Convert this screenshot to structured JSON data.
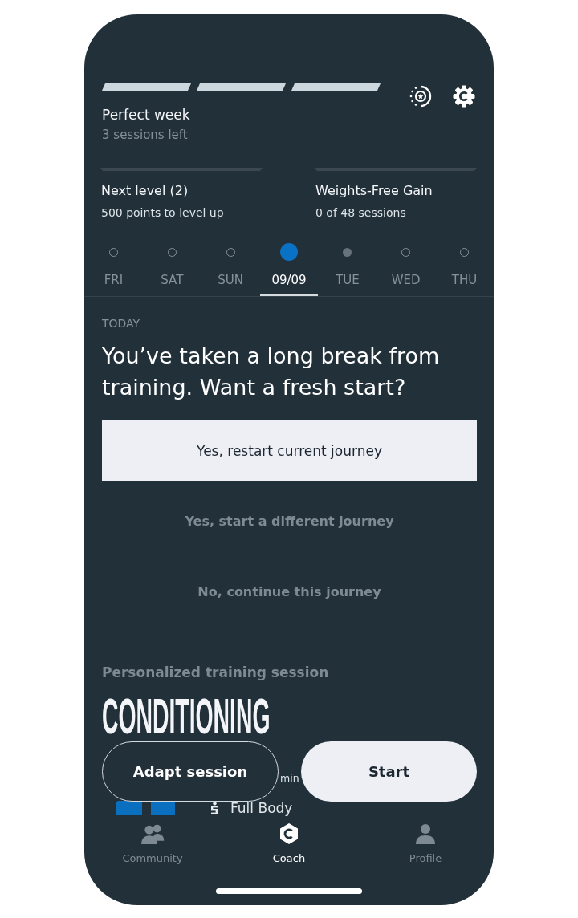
{
  "week_goal": {
    "segments": [
      {
        "filled": true
      },
      {
        "filled": true
      },
      {
        "filled": true
      }
    ],
    "title": "Perfect week",
    "subtitle": "3 sessions left"
  },
  "progress": [
    {
      "title": "Next level (2)",
      "subtitle": "500 points to level up",
      "level": 0
    },
    {
      "title": "Weights-Free Gain",
      "subtitle": "0 of 48 sessions",
      "level": 0
    }
  ],
  "days": [
    {
      "label": "FRI",
      "kind": "empty",
      "selected": false
    },
    {
      "label": "SAT",
      "kind": "empty",
      "selected": false
    },
    {
      "label": "SUN",
      "kind": "empty",
      "selected": false
    },
    {
      "label": "09/09",
      "kind": "current",
      "selected": true
    },
    {
      "label": "TUE",
      "kind": "planned",
      "selected": false
    },
    {
      "label": "WED",
      "kind": "empty",
      "selected": false
    },
    {
      "label": "THU",
      "kind": "empty",
      "selected": false
    }
  ],
  "today": {
    "label": "TODAY",
    "heading": "You’ve taken a long break from training. Want a fresh start?",
    "options": [
      {
        "label": "Yes, restart current journey",
        "kind": "primary"
      },
      {
        "label": "Yes, start a different journey",
        "kind": "text"
      },
      {
        "label": "No, continue this journey",
        "kind": "text"
      }
    ]
  },
  "session": {
    "label": "Personalized training session",
    "title": "CONDITIONING",
    "duration": "min",
    "focus": "Full Body",
    "actions": [
      {
        "label": "Adapt session",
        "kind": "outline"
      },
      {
        "label": "Start",
        "kind": "filled"
      }
    ]
  },
  "nav": [
    {
      "label": "Community",
      "selected": false
    },
    {
      "label": "Coach",
      "selected": true
    },
    {
      "label": "Profile",
      "selected": false
    }
  ]
}
